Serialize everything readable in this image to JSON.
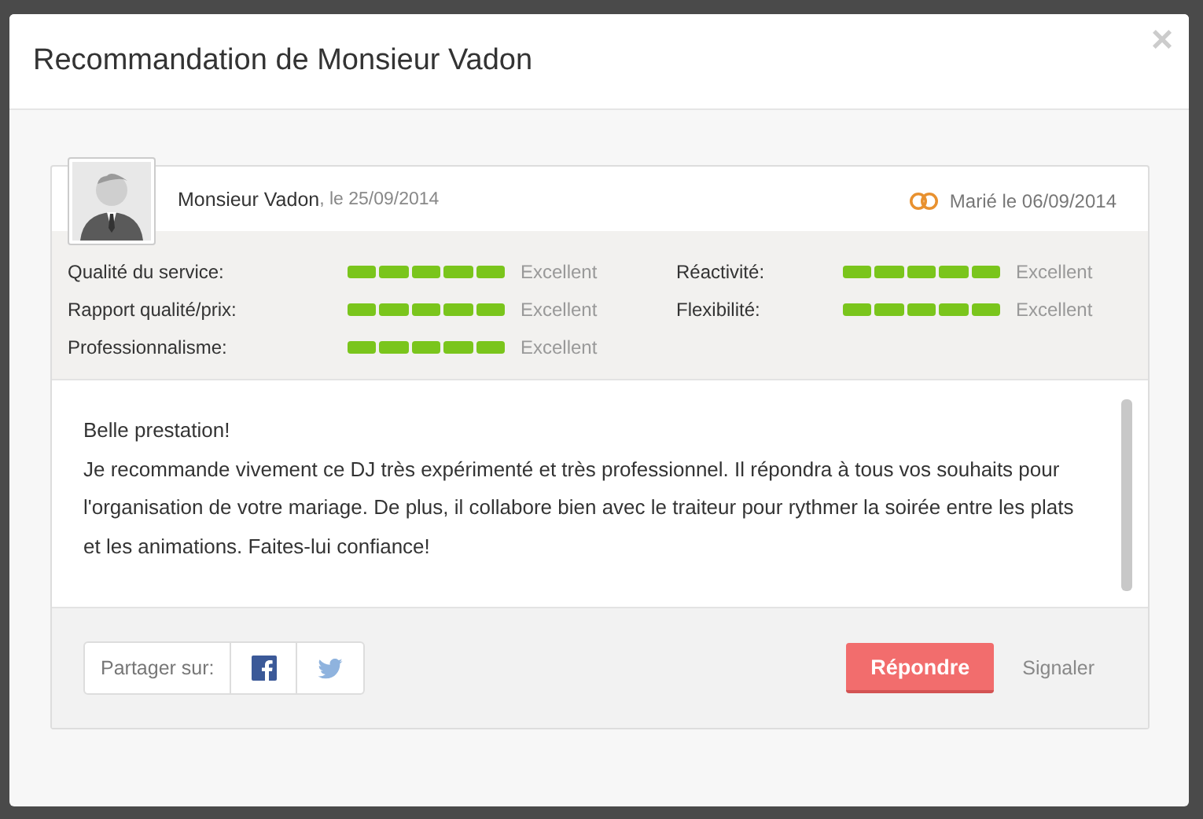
{
  "modal": {
    "title": "Recommandation de Monsieur Vadon",
    "close": "×"
  },
  "review": {
    "author": "Monsieur Vadon",
    "date": ", le 25/09/2014",
    "wedding": "Marié le 06/09/2014",
    "ratings": [
      {
        "label": "Qualité du service:",
        "stars": 5,
        "value": "Excellent"
      },
      {
        "label": "Réactivité:",
        "stars": 5,
        "value": "Excellent"
      },
      {
        "label": "Rapport qualité/prix:",
        "stars": 5,
        "value": "Excellent"
      },
      {
        "label": "Flexibilité:",
        "stars": 5,
        "value": "Excellent"
      },
      {
        "label": "Professionnalisme:",
        "stars": 5,
        "value": "Excellent"
      }
    ],
    "paragraphs": [
      "Belle prestation!",
      "Je recommande vivement ce DJ très expérimenté et très professionnel. Il répondra à tous vos souhaits pour l'organisation de votre mariage. De plus, il collabore bien avec le traiteur pour rythmer la soirée entre les plats et les animations. Faites-lui confiance!"
    ]
  },
  "footer": {
    "share_label": "Partager sur:",
    "reply": "Répondre",
    "report": "Signaler"
  }
}
